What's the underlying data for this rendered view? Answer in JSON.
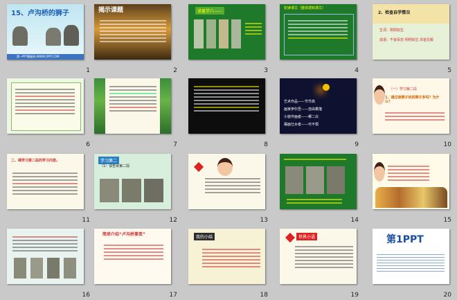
{
  "slides": [
    {
      "num": "1",
      "title": "15、卢沟桥的狮子",
      "footer": "第一PPT模板网-WWW.1PPT.COM"
    },
    {
      "num": "2",
      "title": "揭示课题"
    },
    {
      "num": "3",
      "title": "读童学八——"
    },
    {
      "num": "4",
      "title": "初读课文（整体感知课文）"
    },
    {
      "num": "5",
      "title": "2、检查自学情况",
      "line1": "生词：栩栩如生",
      "line2": "成语：千姿百态 栩栩如生 昂首见鬃"
    },
    {
      "num": "6"
    },
    {
      "num": "7"
    },
    {
      "num": "8"
    },
    {
      "num": "9",
      "p1": "艺术作品——节节高",
      "p2": "画家伊尔吾——自由着描",
      "p3": "小兽作画者——哪二白",
      "p4": "摆画仕女者——可不惧"
    },
    {
      "num": "10",
      "head": "（一）学习第二段",
      "q": "1、通过读狮子状的狮子多吗？为什么？"
    },
    {
      "num": "11",
      "head": "二、细学习第二段的学习内容。"
    },
    {
      "num": "12",
      "head": "学习第二",
      "sub": "（1）请告诉第二段"
    },
    {
      "num": "13"
    },
    {
      "num": "14"
    },
    {
      "num": "15"
    },
    {
      "num": "16"
    },
    {
      "num": "17",
      "head": "简单介绍“卢沟桥事变”"
    },
    {
      "num": "18",
      "head": "我的小结"
    },
    {
      "num": "19",
      "head": "世界小语"
    },
    {
      "num": "20",
      "logo": "第1PPT"
    }
  ],
  "colors": {
    "green": "#2f8f3a",
    "orange": "#e07b16",
    "navy": "#1a2f5c"
  }
}
